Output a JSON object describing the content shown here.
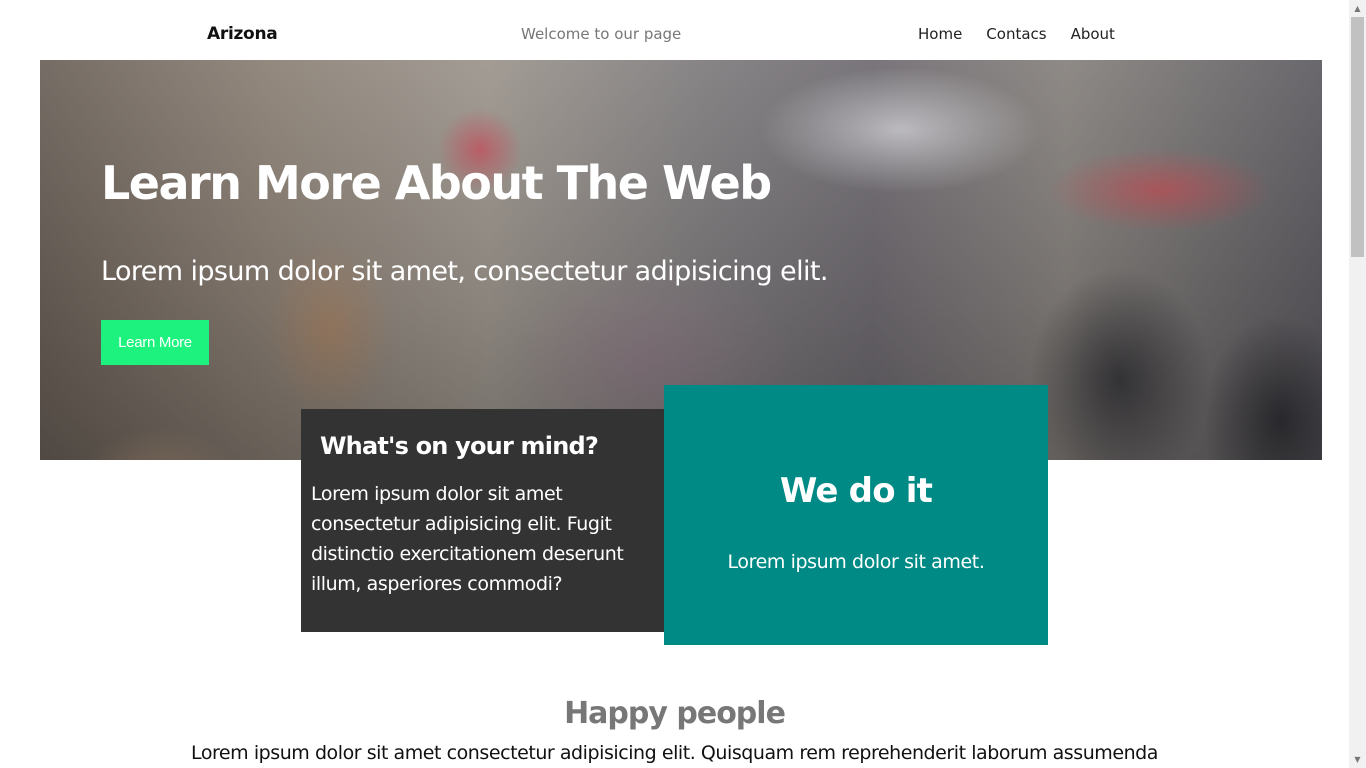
{
  "header": {
    "brand": "Arizona",
    "welcome": "Welcome to our page",
    "nav": [
      {
        "label": "Home"
      },
      {
        "label": "Contacs"
      },
      {
        "label": "About"
      }
    ]
  },
  "hero": {
    "title": "Learn More About The Web",
    "subtitle": "Lorem ipsum dolor sit amet, consectetur adipisicing elit.",
    "button_label": "Learn More"
  },
  "card_dark": {
    "title": "What's on your mind?",
    "text": "Lorem ipsum dolor sit amet consectetur adipisicing elit. Fugit distinctio exercitationem deserunt illum, asperiores commodi?"
  },
  "card_teal": {
    "title": "We do it",
    "text": "Lorem ipsum dolor sit amet."
  },
  "happy": {
    "title": "Happy people",
    "text": "Lorem ipsum dolor sit amet consectetur adipisicing elit. Quisquam rem reprehenderit laborum assumenda"
  },
  "colors": {
    "button_green": "#1ef27e",
    "dark_card": "#333333",
    "teal_card": "#008a86"
  }
}
